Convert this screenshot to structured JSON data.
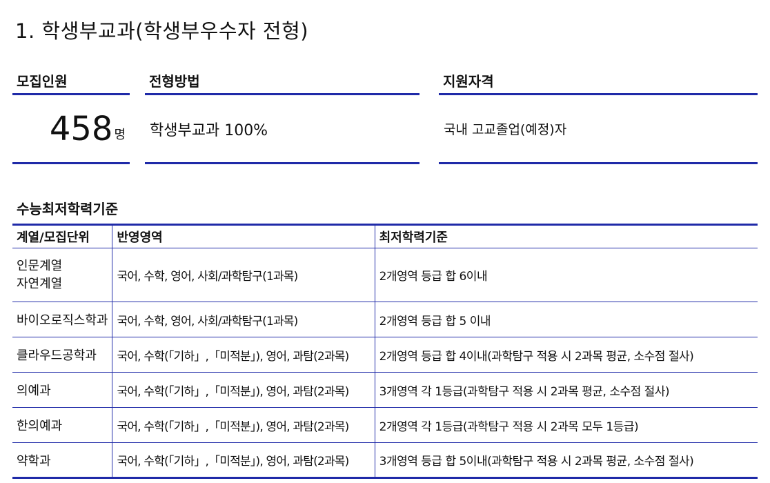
{
  "title": "1.  학생부교과(학생부우수자  전형)",
  "summary": {
    "recruit_header": "모집인원",
    "recruit_number": "458",
    "recruit_unit": "명",
    "method_header": "전형방법",
    "method_value": "학생부교과  100%",
    "qual_header": "지원자격",
    "qual_value": "국내 고교졸업(예정)자"
  },
  "csat": {
    "title": "수능최저학력기준",
    "columns": [
      "계열/모집단위",
      "반영영역",
      "최저학력기준"
    ],
    "rows": [
      {
        "unit": "인문계열",
        "unit2": "자연계열",
        "areas": "국어, 수학, 영어, 사회/과학탐구(1과목)",
        "criterion": "2개영역 등급 합 6이내"
      },
      {
        "unit": "바이오로직스학과",
        "unit2": "",
        "areas": "국어,  수학,  영어,  사회/과학탐구(1과목)",
        "criterion": "2개영역  등급  합  5  이내"
      },
      {
        "unit": "클라우드공학과",
        "unit2": "",
        "areas": "국어, 수학(「기하」,「미적분」), 영어, 과탐(2과목)",
        "criterion": "2개영역 등급 합 4이내(과학탐구 적용 시 2과목 평균, 소수점 절사)"
      },
      {
        "unit": "의예과",
        "unit2": "",
        "areas": " 국어, 수학(「기하」,「미적분」), 영어, 과탐(2과목)",
        "criterion": "3개영역 각 1등급(과학탐구 적용 시 2과목 평균, 소수점 절사)"
      },
      {
        "unit": "한의예과",
        "unit2": "",
        "areas": " 국어, 수학(「기하」,「미적분」), 영어, 과탐(2과목)",
        "criterion": "2개영역 각 1등급(과학탐구 적용 시 2과목 모두 1등급)"
      },
      {
        "unit": "약학과",
        "unit2": "",
        "areas": " 국어, 수학(「기하」,「미적분」), 영어, 과탐(2과목)",
        "criterion": "3개영역 등급 합 5이내(과학탐구 적용 시 2과목 평균, 소수점 절사)"
      }
    ]
  },
  "colors": {
    "rule": "#1f2aa8",
    "text": "#111111"
  }
}
